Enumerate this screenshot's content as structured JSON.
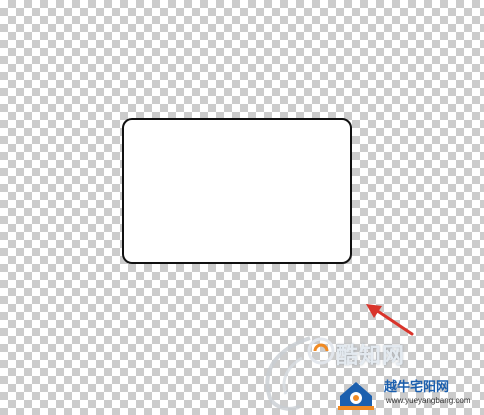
{
  "canvas": {
    "transparent_pattern": true
  },
  "shape": {
    "type": "rounded-rectangle",
    "fill": "#ffffff",
    "stroke": "#111111"
  },
  "annotation": {
    "arrow_color": "#d9342b"
  },
  "watermark": {
    "site_name": "酷知网",
    "site_name_2": "越牛宅阳网",
    "url": "www.yueyangbang.com",
    "logo_color": "#1b5fae",
    "accent_color": "#f08a24"
  }
}
